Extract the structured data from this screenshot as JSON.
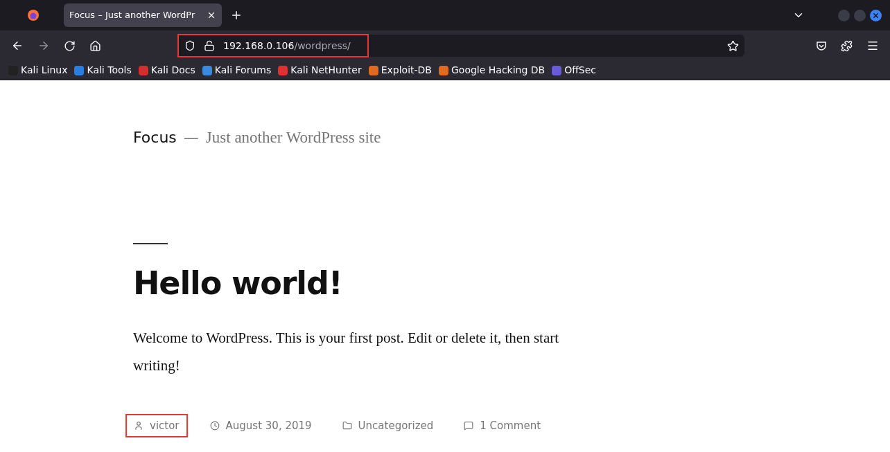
{
  "tab": {
    "title": "Focus – Just another WordPr",
    "selected": true
  },
  "address_bar": {
    "host": "192.168.0.106",
    "path": "/wordpress/",
    "highlighted": true
  },
  "bookmarks": [
    {
      "label": "Kali Linux",
      "color": "#222222"
    },
    {
      "label": "Kali Tools",
      "color": "#2a7de1"
    },
    {
      "label": "Kali Docs",
      "color": "#d32f2f"
    },
    {
      "label": "Kali Forums",
      "color": "#3a8be0"
    },
    {
      "label": "Kali NetHunter",
      "color": "#e03030"
    },
    {
      "label": "Exploit-DB",
      "color": "#e06a20"
    },
    {
      "label": "Google Hacking DB",
      "color": "#e06a20"
    },
    {
      "label": "OffSec",
      "color": "#6a5cd8"
    }
  ],
  "site": {
    "title": "Focus",
    "separator": "—",
    "tagline": "Just another WordPress site"
  },
  "post": {
    "title": "Hello world!",
    "body": "Welcome to WordPress. This is your first post. Edit or delete it, then start writing!",
    "meta": [
      {
        "kind": "author",
        "text": "victor",
        "highlighted": true
      },
      {
        "kind": "date",
        "text": "August 30, 2019",
        "highlighted": false
      },
      {
        "kind": "category",
        "text": "Uncategorized",
        "highlighted": false
      },
      {
        "kind": "comments",
        "text": "1 Comment",
        "highlighted": false
      }
    ]
  }
}
